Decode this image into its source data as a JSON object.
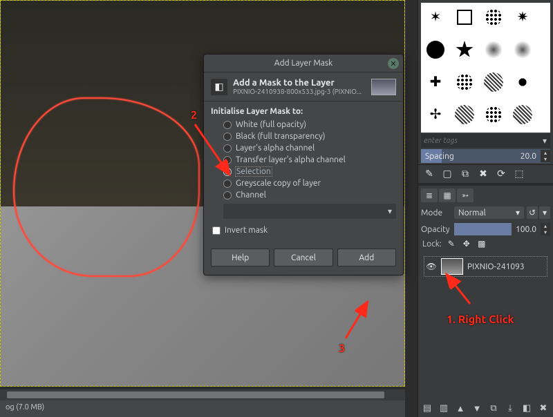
{
  "status_text": "og (7.0 MB)",
  "dialog": {
    "title": "Add Layer Mask",
    "header_title": "Add a Mask to the Layer",
    "header_sub": "PIXNIO-2410938-800x533.jpg-3 (PIXNIO...",
    "init_label": "Initialise Layer Mask to:",
    "options": {
      "white": "White (full opacity)",
      "black": "Black (full transparency)",
      "alpha": "Layer's alpha channel",
      "transfer": "Transfer layer's alpha channel",
      "selection": "Selection",
      "greyscale": "Greyscale copy of layer",
      "channel": "Channel"
    },
    "invert_label": "Invert mask",
    "buttons": {
      "help": "Help",
      "cancel": "Cancel",
      "add": "Add"
    }
  },
  "right": {
    "tags_placeholder": "enter tags",
    "spacing_label": "Spacing",
    "spacing_value": "20.0",
    "mode_label": "Mode",
    "mode_value": "Normal",
    "opacity_label": "Opacity",
    "opacity_value": "100.0",
    "lock_label": "Lock:",
    "layer_name": "PIXNIO-241093"
  },
  "annotations": {
    "n2": "2",
    "n3": "3",
    "rc": "1. Right Click"
  }
}
